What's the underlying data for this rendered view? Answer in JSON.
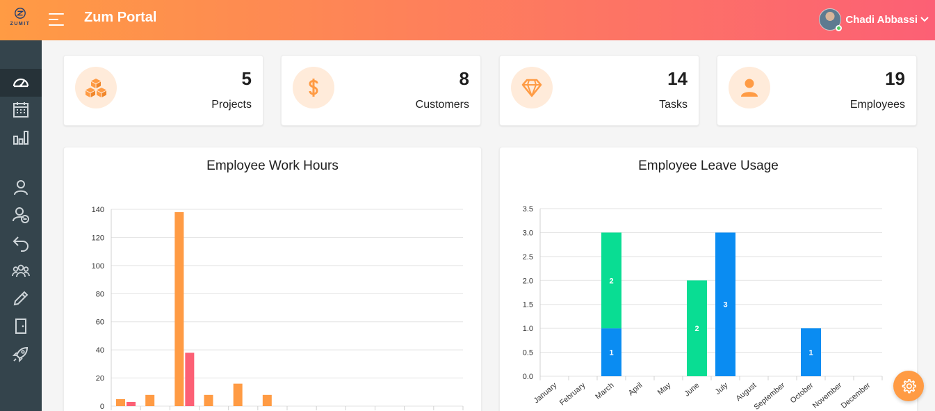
{
  "app": {
    "title": "Zum Portal",
    "logo_text": "ZUMIT"
  },
  "user": {
    "name": "Chadi Abbassi"
  },
  "colors": {
    "accent": "#ff9b44",
    "accent2": "#fc6075",
    "blue": "#0a8cf2",
    "green": "#09dd93",
    "sidebar": "#34444c"
  },
  "sidebar": {
    "items": [
      {
        "icon": "dashboard-icon",
        "active": true
      },
      {
        "icon": "calendar-icon"
      },
      {
        "icon": "bar-chart-icon"
      },
      {
        "icon": "user-icon"
      },
      {
        "icon": "user-minus-icon"
      },
      {
        "icon": "undo-icon"
      },
      {
        "icon": "users-icon"
      },
      {
        "icon": "pencil-icon"
      },
      {
        "icon": "door-icon"
      },
      {
        "icon": "rocket-icon"
      }
    ]
  },
  "stats": [
    {
      "icon": "cubes-icon",
      "value": "5",
      "label": "Projects"
    },
    {
      "icon": "dollar-icon",
      "value": "8",
      "label": "Customers"
    },
    {
      "icon": "diamond-icon",
      "value": "14",
      "label": "Tasks"
    },
    {
      "icon": "user-icon",
      "value": "19",
      "label": "Employees"
    }
  ],
  "chart_data": [
    {
      "type": "bar",
      "title": "Employee Work Hours",
      "ylim": [
        0,
        140
      ],
      "yticks": [
        "0",
        "20",
        "40",
        "60",
        "80",
        "100",
        "120",
        "140"
      ],
      "grid": true,
      "series": [
        {
          "color": "#ff9b44",
          "values": [
            5,
            8,
            138,
            8,
            16,
            8,
            0,
            0,
            0,
            0,
            0,
            0
          ]
        },
        {
          "color": "#fc6075",
          "values": [
            3,
            0,
            38,
            0,
            0,
            0,
            0,
            0,
            0,
            0,
            0,
            0
          ]
        }
      ]
    },
    {
      "type": "bar",
      "stacked": true,
      "title": "Employee Leave Usage",
      "categories": [
        "January",
        "February",
        "March",
        "April",
        "May",
        "June",
        "July",
        "August",
        "September",
        "October",
        "November",
        "December"
      ],
      "ylim": [
        0,
        3.5
      ],
      "yticks": [
        "0.0",
        "0.5",
        "1.0",
        "1.5",
        "2.0",
        "2.5",
        "3.0",
        "3.5"
      ],
      "grid": true,
      "series": [
        {
          "color": "#0a8cf2",
          "values": [
            0,
            0,
            1,
            0,
            0,
            0,
            3,
            0,
            0,
            1,
            0,
            0
          ]
        },
        {
          "color": "#09dd93",
          "values": [
            0,
            0,
            2,
            0,
            0,
            2,
            0,
            0,
            0,
            0,
            0,
            0
          ]
        }
      ]
    }
  ]
}
